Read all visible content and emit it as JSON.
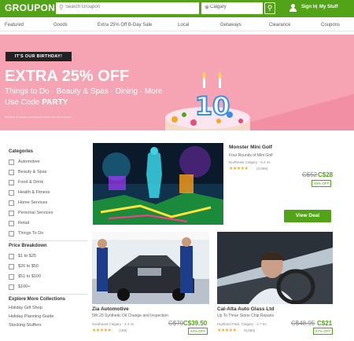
{
  "header": {
    "logo": "GROUPON",
    "search_placeholder": "Search Groupon",
    "location_value": "Calgary",
    "sign_in": "Sign In",
    "separator": "|",
    "my_stuff": "My Stuff"
  },
  "nav": [
    "Featured",
    "Goods",
    "Extra 25% Off B-Day Sale",
    "Local",
    "Getaways",
    "Clearance",
    "Coupons"
  ],
  "banner": {
    "badge": "IT'S OUR BIRTHDAY!",
    "headline": "EXTRA 25% OFF",
    "subline": "Things to Do · Beauty & Spas · Dining · More",
    "code_prefix": "Use Code ",
    "code": "PARTY",
    "fine_print": "Valid 4/13 on Groupon and Groupon Goods. See site for details.",
    "cake_number": "10",
    "colors": {
      "background": "#f6a3b3",
      "accent": "#f28fa4"
    }
  },
  "sidebar": {
    "categories_title": "Categories",
    "categories": [
      "Automotive",
      "Beauty & Spas",
      "Food & Drink",
      "Health & Fitness",
      "Home Services",
      "Personal Services",
      "Retail",
      "Things To Do"
    ],
    "price_title": "Price Breakdown",
    "prices": [
      "$1 to $25",
      "$26 to $50",
      "$51 to $100",
      "$100+"
    ],
    "collections_title": "Explore More Collections",
    "collections": [
      "Holiday Gift Shop",
      "Holiday Planning Guide",
      "Stocking Stuffers"
    ]
  },
  "deals": [
    {
      "title": "Monster Mini Golf",
      "subtitle": "Four Rounds of Mini Golf",
      "location": "Northeast Calgary · 5.2 mi",
      "stars": "★★★★★",
      "reviews": "(3,059)",
      "old_price": "C$52",
      "new_price": "C$28",
      "discount": "46% OFF",
      "cta": "View Deal"
    },
    {
      "title": "Zia Automotive",
      "subtitle": "5W-20 Synthetic Oil Change and Inspection",
      "location": "Southeast Calgary · 4.4 mi",
      "stars": "★★★★★",
      "reviews": "(165)",
      "old_price": "C$70",
      "new_price": "C$39.50",
      "discount": "44% OFF"
    },
    {
      "title": "Cal-Alta Auto Glass Ltd",
      "subtitle": "Up To Three Stone Chip Repairs",
      "location": "Highland Park, Calgary · 4.7 mi",
      "stars": "★★★★★",
      "reviews": "(6,060)",
      "old_price": "C$48.95",
      "new_price": "C$21",
      "discount": "57% OFF"
    }
  ],
  "colors": {
    "brand": "#53a318",
    "star": "#f4a821"
  }
}
